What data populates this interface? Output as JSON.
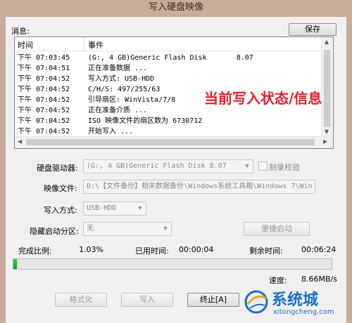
{
  "window": {
    "title": "写入硬盘映像"
  },
  "log": {
    "label": "消息:",
    "save_label": "保存",
    "columns": [
      "时间",
      "事件"
    ],
    "rows": [
      {
        "time": "下午 07:03:45",
        "event": "(G:, 4 GB)Generic Flash Disk       8.07"
      },
      {
        "time": "下午 07:04:51",
        "event": "正在准备数据 ..."
      },
      {
        "time": "下午 07:04:52",
        "event": "写入方式: USB-HDD"
      },
      {
        "time": "下午 07:04:52",
        "event": "C/H/S: 497/255/63"
      },
      {
        "time": "下午 07:04:52",
        "event": "引导扇区: WinVista/7/8"
      },
      {
        "time": "下午 07:04:52",
        "event": "正在准备介质 ..."
      },
      {
        "time": "下午 07:04:52",
        "event": "ISO 映像文件的扇区数为 6730712"
      },
      {
        "time": "下午 07:04:52",
        "event": "开始写入 ..."
      }
    ]
  },
  "overlay_note": "当前写入状态/信息",
  "form": {
    "drive_label": "硬盘驱动器:",
    "drive_value": "(G:, 4 GB)Generic Flash Disk      8.07",
    "verify_label": "刻录校验",
    "image_label": "映像文件:",
    "image_value": "D:\\【文件备份】相关数据备份\\Windows系统工具箱\\Windows 7\\Win",
    "method_label": "写入方式:",
    "method_value": "USB-HDD",
    "hidden_label": "隐藏启动分区:",
    "hidden_value": "无",
    "quick_boot_label": "便捷启动"
  },
  "status": {
    "ratio_label": "完成比例:",
    "ratio_value": "1.03%",
    "progress_fraction": 0.0103,
    "elapsed_label": "已用时间:",
    "elapsed_value": "00:00:04",
    "remaining_label": "剩余时间:",
    "remaining_value": "00:06:24",
    "speed_label": "速度:",
    "speed_value": "8.66MB/s"
  },
  "buttons": {
    "format": "格式化",
    "write": "写入",
    "stop": "终止[A]"
  },
  "watermark": {
    "cn": "系统城",
    "en": "xitongcheng.com"
  },
  "colors": {
    "progress": "#07a818",
    "overlay": "#e1202d",
    "watermark": "#1a6fc8"
  }
}
